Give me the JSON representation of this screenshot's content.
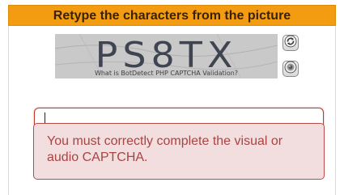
{
  "captcha": {
    "title": "Retype the characters from the picture",
    "image_text": "PS8TX",
    "image_link_text": "What is BotDetect PHP CAPTCHA Validation?",
    "reload_icon": "reload-icon",
    "sound_icon": "speaker-icon",
    "input_value": "",
    "error_message": "You must correctly complete the visual or audio CAPTCHA."
  },
  "colors": {
    "header_bg": "#f39c12",
    "error_bg": "#f2dede",
    "error_text": "#a94442",
    "error_border": "#b94a48"
  }
}
